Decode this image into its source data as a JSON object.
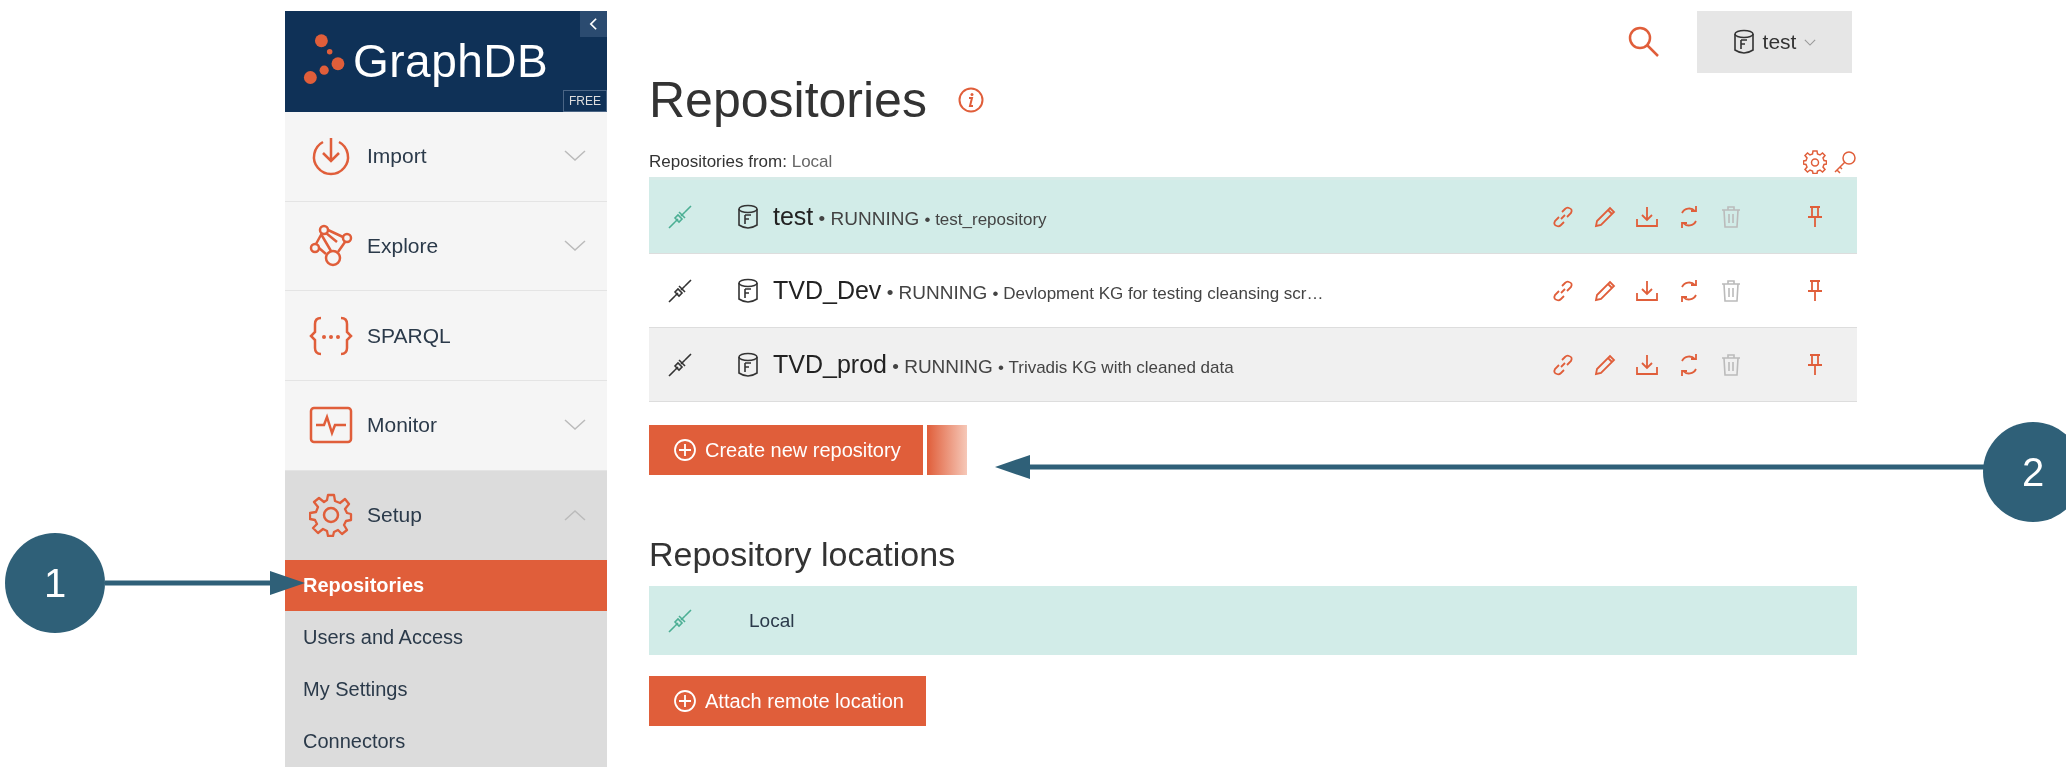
{
  "sidebar": {
    "logo": "GraphDB",
    "edition": "FREE",
    "items": [
      {
        "label": "Import",
        "expanded": false
      },
      {
        "label": "Explore",
        "expanded": false
      },
      {
        "label": "SPARQL"
      },
      {
        "label": "Monitor",
        "expanded": false
      },
      {
        "label": "Setup",
        "expanded": true,
        "children": [
          {
            "label": "Repositories",
            "selected": true
          },
          {
            "label": "Users and Access",
            "selected": false
          },
          {
            "label": "My Settings",
            "selected": false
          },
          {
            "label": "Connectors",
            "selected": false
          }
        ]
      }
    ]
  },
  "header": {
    "repository_selector": "test"
  },
  "title": "Repositories",
  "repositories_from": {
    "label": "Repositories from:",
    "value": "Local"
  },
  "repositories": [
    {
      "name": "test",
      "status": "• RUNNING",
      "description": "• test_repository",
      "selected": true,
      "hovered": false
    },
    {
      "name": "TVD_Dev",
      "status": "• RUNNING",
      "description": "• Devlopment KG for testing cleansing scr…",
      "selected": false,
      "hovered": false
    },
    {
      "name": "TVD_prod",
      "status": "• RUNNING",
      "description": "• Trivadis KG with cleaned data",
      "selected": false,
      "hovered": true
    }
  ],
  "create_button": "Create new repository",
  "locations_title": "Repository locations",
  "locations": [
    {
      "name": "Local",
      "selected": true
    }
  ],
  "attach_button": "Attach remote location",
  "callouts": [
    "1",
    "2"
  ]
}
